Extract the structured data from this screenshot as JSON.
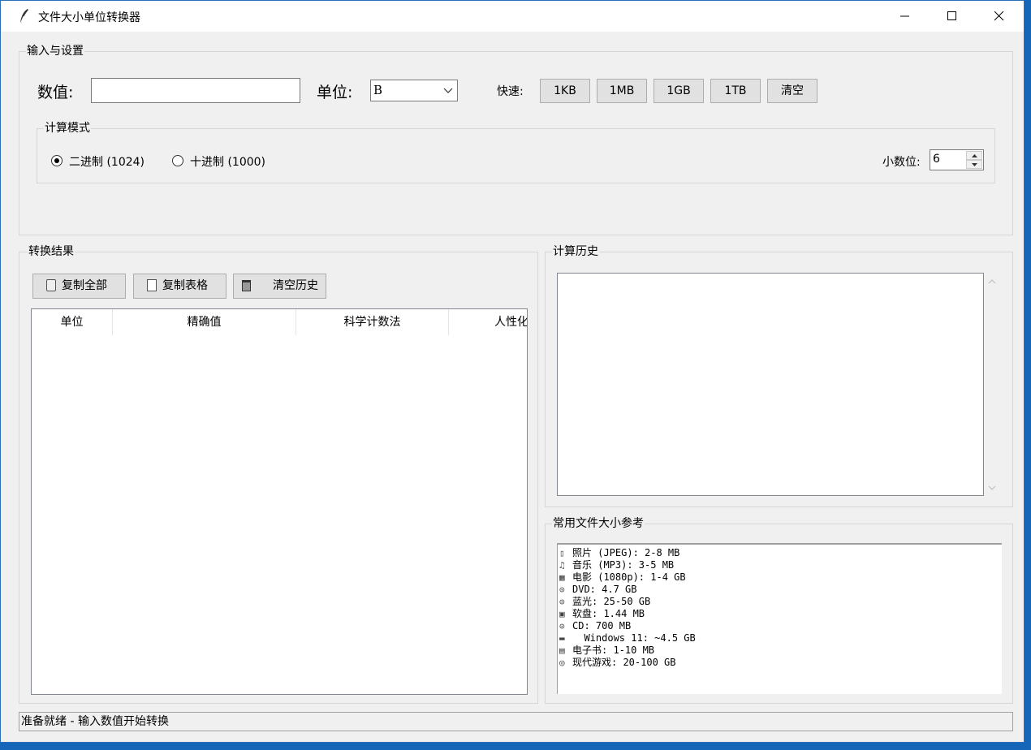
{
  "window": {
    "title": "文件大小单位转换器"
  },
  "input_group": {
    "label": "输入与设置",
    "value_label": "数值:",
    "value_input": "",
    "unit_label": "单位:",
    "unit_selected": "B",
    "quick_label": "快速:",
    "quick_buttons": [
      "1KB",
      "1MB",
      "1GB",
      "1TB",
      "清空"
    ],
    "mode_group": {
      "label": "计算模式",
      "binary_label": "二进制 (1024)",
      "decimal_label": "十进制 (1000)",
      "selected": "binary",
      "decimals_label": "小数位:",
      "decimals_value": "6"
    }
  },
  "results": {
    "label": "转换结果",
    "copy_all": "复制全部",
    "copy_table": "复制表格",
    "clear_history": "清空历史",
    "columns": [
      "单位",
      "精确值",
      "科学计数法",
      "人性化"
    ]
  },
  "history": {
    "label": "计算历史"
  },
  "reference": {
    "label": "常用文件大小参考",
    "items": [
      {
        "icon": "phone-icon",
        "glyph": "▯",
        "text": "照片 (JPEG): 2-8 MB"
      },
      {
        "icon": "music-icon",
        "glyph": "♫",
        "text": "音乐 (MP3): 3-5 MB"
      },
      {
        "icon": "film-icon",
        "glyph": "▦",
        "text": "电影 (1080p): 1-4 GB"
      },
      {
        "icon": "disc-icon",
        "glyph": "⊙",
        "text": "DVD: 4.7 GB"
      },
      {
        "icon": "disc-icon",
        "glyph": "⊙",
        "text": "蓝光: 25-50 GB"
      },
      {
        "icon": "floppy-icon",
        "glyph": "▣",
        "text": "软盘: 1.44 MB"
      },
      {
        "icon": "disc-icon",
        "glyph": "⊙",
        "text": "CD: 700 MB"
      },
      {
        "icon": "computer-icon",
        "glyph": "▬",
        "text": "  Windows 11: ~4.5 GB"
      },
      {
        "icon": "book-icon",
        "glyph": "▤",
        "text": "电子书: 1-10 MB"
      },
      {
        "icon": "gamepad-icon",
        "glyph": "◎",
        "text": "现代游戏: 20-100 GB"
      }
    ]
  },
  "status": {
    "text": "准备就绪 - 输入数值开始转换"
  }
}
